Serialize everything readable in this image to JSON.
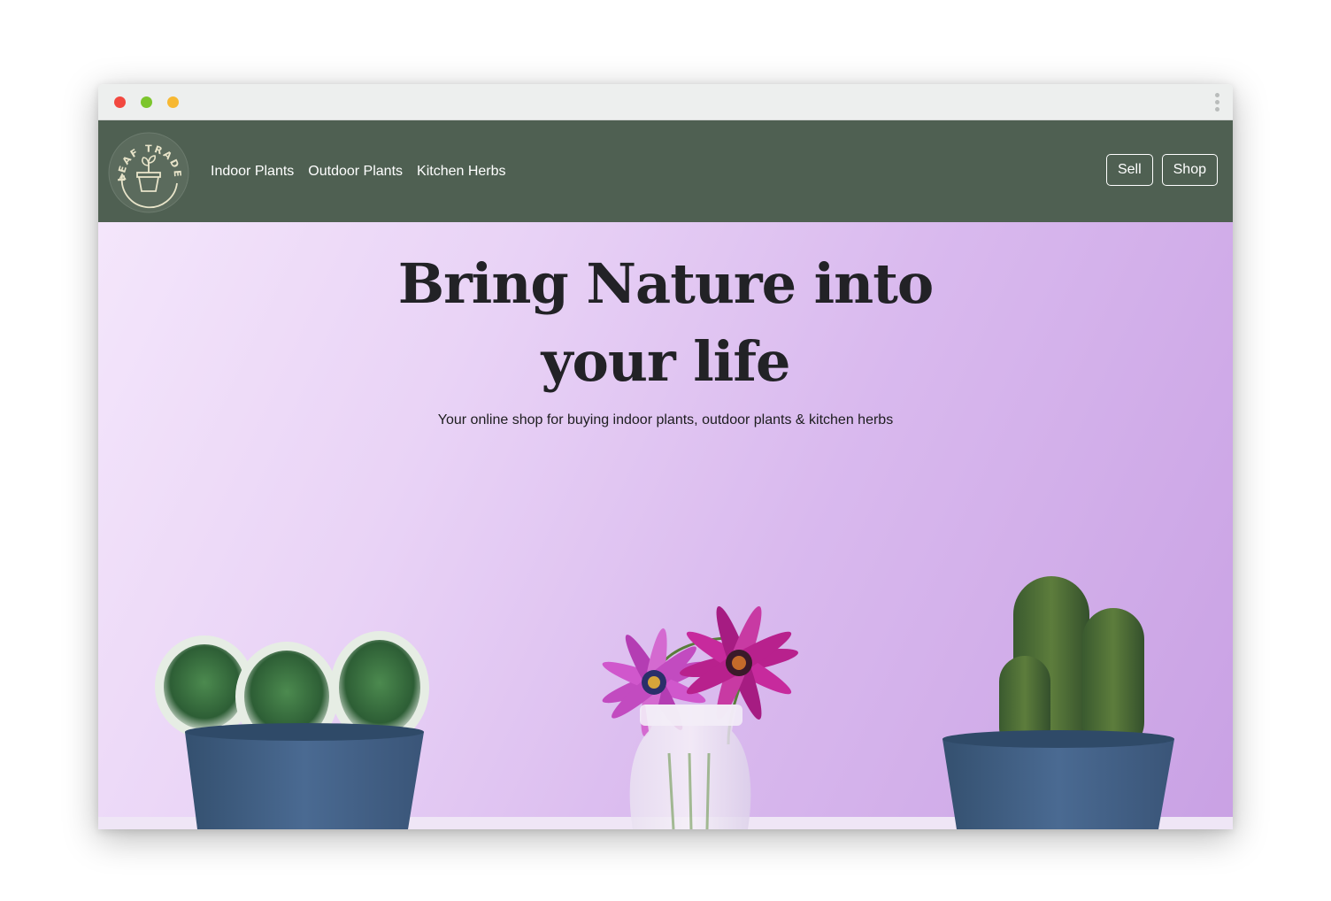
{
  "window": {
    "controls": [
      "close-dot",
      "minimize-dot",
      "maximize-dot"
    ],
    "menu_icon": "kebab-menu-icon"
  },
  "brand": {
    "logo_text": "LEAF TRADE",
    "logo_icon": "sprout-pot-icon"
  },
  "nav": {
    "links": [
      {
        "label": "Indoor Plants"
      },
      {
        "label": "Outdoor Plants"
      },
      {
        "label": "Kitchen Herbs"
      }
    ],
    "buttons": {
      "sell_label": "Sell",
      "shop_label": "Shop"
    }
  },
  "hero": {
    "title_line1": "Bring Nature into",
    "title_line2": "your life",
    "subtitle": "Your online shop for buying indoor plants, outdoor plants & kitchen herbs"
  },
  "colors": {
    "navbar": "#4f6052",
    "titlebar": "#edefee",
    "hero_bg_start": "#f4e6fb",
    "hero_bg_end": "#c9a1e4",
    "pot": "#3e5d84",
    "logo_ring": "#e8e4c9"
  }
}
